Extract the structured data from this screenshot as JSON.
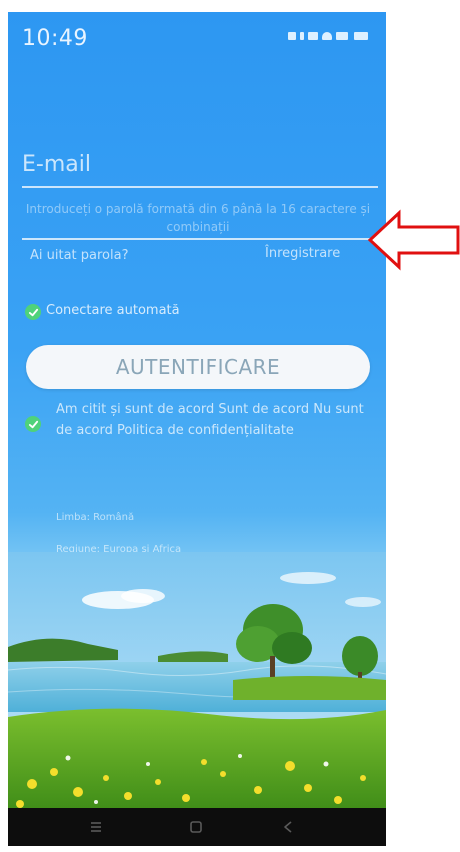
{
  "status_bar": {
    "time": "10:49"
  },
  "login": {
    "email_placeholder": "E-mail",
    "password_placeholder": "Introduceți o parolă formată din 6 până la 16 caractere și combinații",
    "forgot_password": "Ai uitat parola?",
    "register": "Înregistrare",
    "auto_connect": "Conectare automată",
    "auto_connect_checked": true,
    "login_button": "AUTENTIFICARE",
    "terms": {
      "checked": true,
      "text1": "Am citit și sunt de acord",
      "link1": "Sunt de acord",
      "link2": "Nu sunt de acord",
      "link3": "Politica de confidențialitate"
    },
    "language": "Limba: Română",
    "region": "Regiune: Europa și Africa"
  },
  "colors": {
    "background_top": "#2d97f2",
    "check_green": "#4fd27a",
    "arrow_red": "#e01010"
  },
  "icons": {
    "nav": [
      "menu-icon",
      "home-icon",
      "back-icon"
    ],
    "annotation": "red-arrow-icon"
  }
}
